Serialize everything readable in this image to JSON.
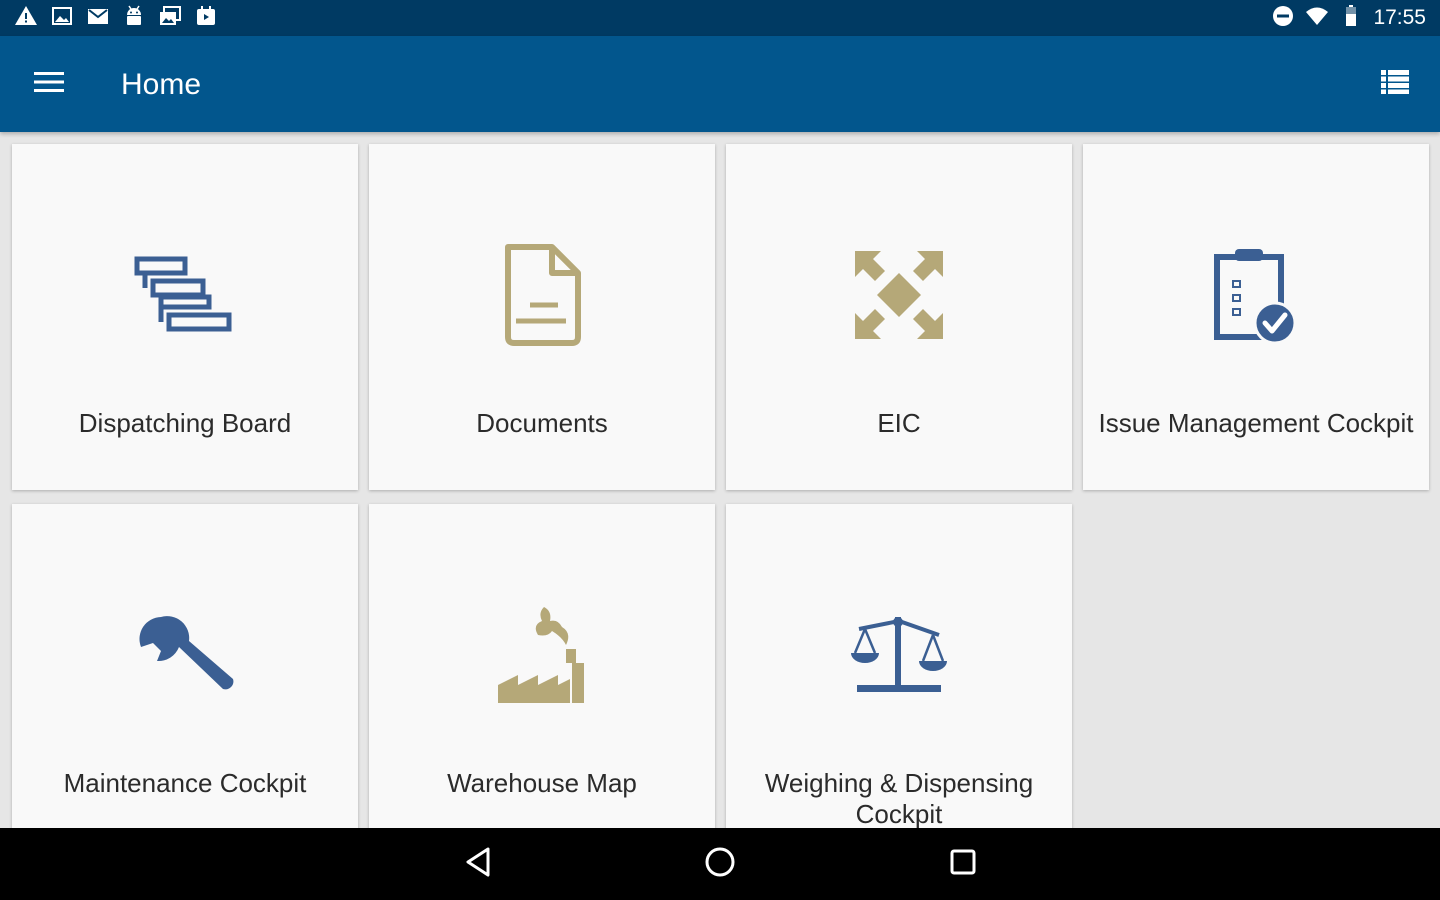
{
  "status_bar": {
    "time": "17:55",
    "left_icons": [
      "warning-icon",
      "image-icon",
      "mail-icon",
      "android-icon",
      "gallery-icon",
      "calendar-icon"
    ],
    "right_icons": [
      "do-not-disturb-icon",
      "wifi-icon",
      "battery-icon"
    ]
  },
  "app_bar": {
    "title": "Home",
    "menu_icon": "hamburger-menu-icon",
    "view_icon": "list-view-icon"
  },
  "tiles": [
    {
      "label": "Dispatching Board",
      "icon": "dispatching-board-icon"
    },
    {
      "label": "Documents",
      "icon": "document-icon"
    },
    {
      "label": "EIC",
      "icon": "expand-arrows-icon"
    },
    {
      "label": "Issue Management Cockpit",
      "icon": "clipboard-check-icon"
    },
    {
      "label": "Maintenance Cockpit",
      "icon": "wrench-icon"
    },
    {
      "label": "Warehouse Map",
      "icon": "factory-icon"
    },
    {
      "label": "Weighing & Dispensing Cockpit",
      "icon": "scale-icon"
    }
  ],
  "nav_bar": {
    "icons": [
      "back-icon",
      "home-icon",
      "recents-icon"
    ]
  },
  "colors": {
    "status_bar": "#003a63",
    "app_bar": "#02568d",
    "icon_blue": "#3b5f93",
    "icon_gold": "#b5a878",
    "tile_bg": "#f9f9f9",
    "page_bg": "#e6e6e6"
  }
}
